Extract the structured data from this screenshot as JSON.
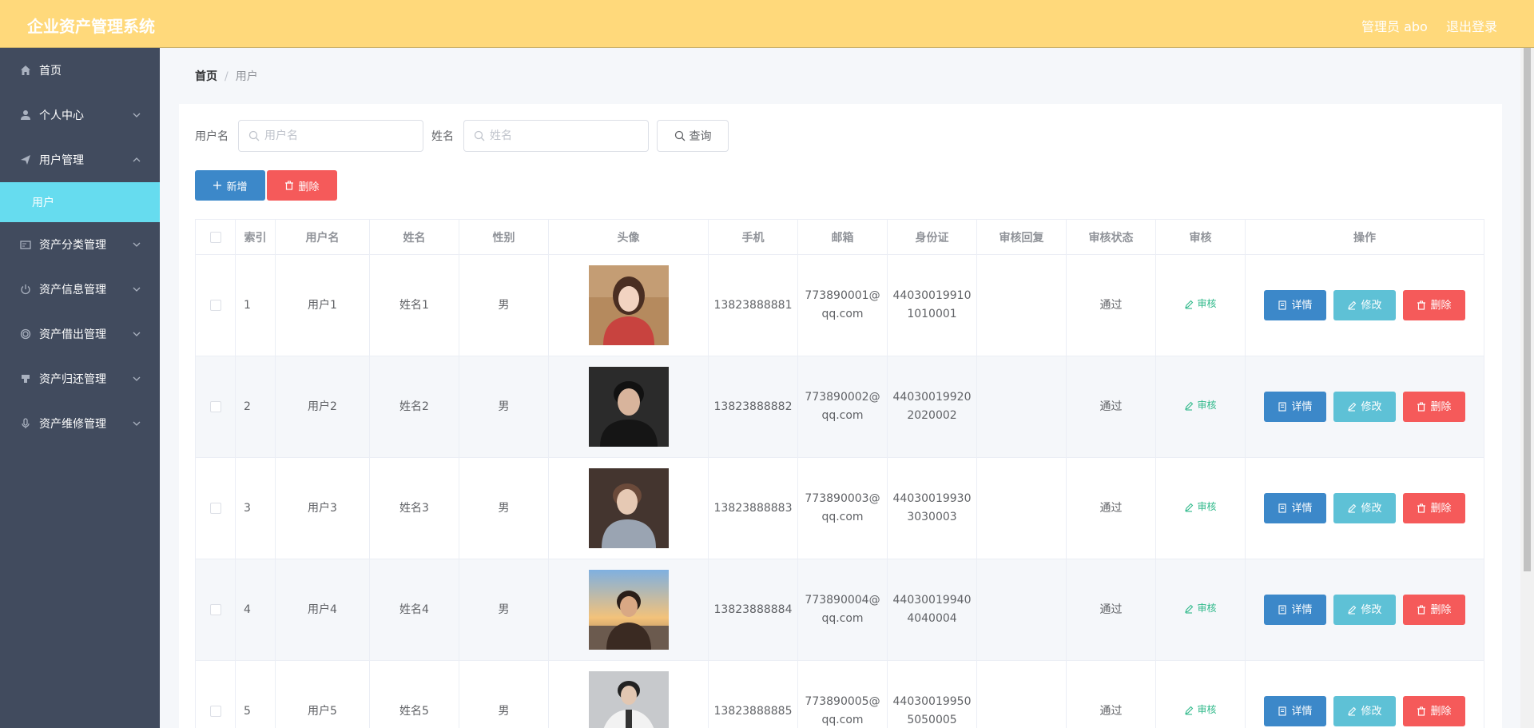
{
  "header": {
    "title": "企业资产管理系统",
    "user": "管理员 abo",
    "logout": "退出登录",
    "bg_color": "#ffd97b"
  },
  "sidebar": {
    "bg_color": "#414b5e",
    "items": [
      {
        "label": "首页",
        "icon": "home-icon",
        "arrow": ""
      },
      {
        "label": "个人中心",
        "icon": "user-icon",
        "arrow": "down"
      },
      {
        "label": "用户管理",
        "icon": "send-icon",
        "arrow": "up"
      },
      {
        "label": "资产分类管理",
        "icon": "card-icon",
        "arrow": "down"
      },
      {
        "label": "资产信息管理",
        "icon": "power-icon",
        "arrow": "down"
      },
      {
        "label": "资产借出管理",
        "icon": "circle-icon",
        "arrow": "down"
      },
      {
        "label": "资产归还管理",
        "icon": "stamp-icon",
        "arrow": "down"
      },
      {
        "label": "资产维修管理",
        "icon": "microphone-icon",
        "arrow": "down"
      }
    ],
    "active_sub": "用户",
    "active_color": "#66dcef"
  },
  "breadcrumb": {
    "home": "首页",
    "sep": "/",
    "current": "用户"
  },
  "search": {
    "username_label": "用户名",
    "username_placeholder": "用户名",
    "name_label": "姓名",
    "name_placeholder": "姓名",
    "query": "查询"
  },
  "actions": {
    "add": "新增",
    "delete": "删除"
  },
  "table": {
    "columns": [
      "",
      "索引",
      "用户名",
      "姓名",
      "性别",
      "头像",
      "手机",
      "邮箱",
      "身份证",
      "审核回复",
      "审核状态",
      "审核",
      "操作"
    ],
    "audit_label": "审核",
    "btn_detail": "详情",
    "btn_edit": "修改",
    "btn_delete": "删除",
    "rows": [
      {
        "index": "1",
        "username": "用户1",
        "name": "姓名1",
        "gender": "男",
        "phone": "13823888881",
        "email1": "773890001@",
        "email2": "qq.com",
        "id1": "44030019910",
        "id2": "1010001",
        "reply": "",
        "status": "通过",
        "avatar": "person-red-shirt"
      },
      {
        "index": "2",
        "username": "用户2",
        "name": "姓名2",
        "gender": "男",
        "phone": "13823888882",
        "email1": "773890002@",
        "email2": "qq.com",
        "id1": "44030019920",
        "id2": "2020002",
        "reply": "",
        "status": "通过",
        "avatar": "person-dark"
      },
      {
        "index": "3",
        "username": "用户3",
        "name": "姓名3",
        "gender": "男",
        "phone": "13823888883",
        "email1": "773890003@",
        "email2": "qq.com",
        "id1": "44030019930",
        "id2": "3030003",
        "reply": "",
        "status": "通过",
        "avatar": "person-grey-shirt"
      },
      {
        "index": "4",
        "username": "用户4",
        "name": "姓名4",
        "gender": "男",
        "phone": "13823888884",
        "email1": "773890004@",
        "email2": "qq.com",
        "id1": "44030019940",
        "id2": "4040004",
        "reply": "",
        "status": "通过",
        "avatar": "person-sunset"
      },
      {
        "index": "5",
        "username": "用户5",
        "name": "姓名5",
        "gender": "男",
        "phone": "13823888885",
        "email1": "773890005@",
        "email2": "qq.com",
        "id1": "44030019950",
        "id2": "5050005",
        "reply": "",
        "status": "通过",
        "avatar": "person-white-jacket"
      }
    ]
  }
}
